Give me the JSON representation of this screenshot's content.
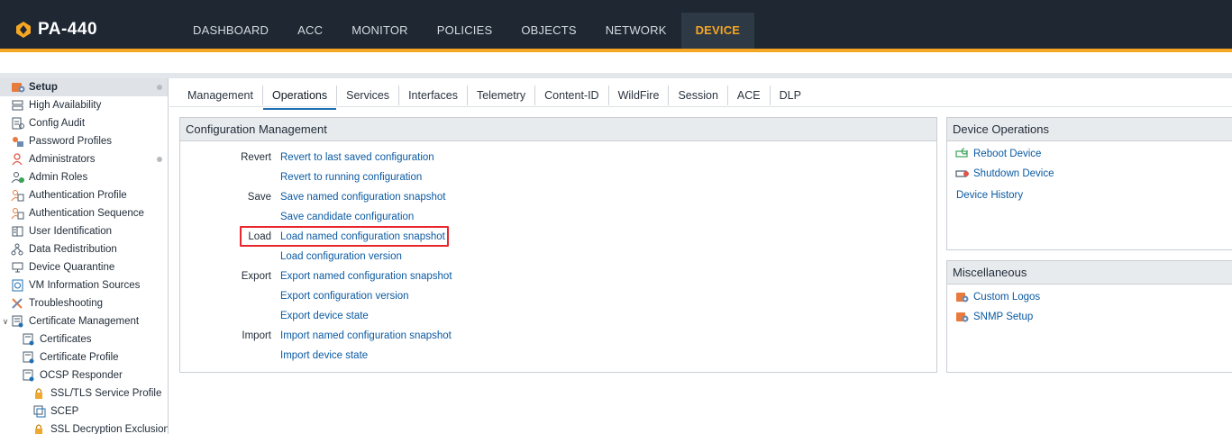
{
  "brand": {
    "name": "PA-440",
    "accent_color": "#f5a623",
    "header_bg": "#1e2732"
  },
  "nav": {
    "items": [
      {
        "label": "DASHBOARD",
        "active": false
      },
      {
        "label": "ACC",
        "active": false
      },
      {
        "label": "MONITOR",
        "active": false
      },
      {
        "label": "POLICIES",
        "active": false
      },
      {
        "label": "OBJECTS",
        "active": false
      },
      {
        "label": "NETWORK",
        "active": false
      },
      {
        "label": "DEVICE",
        "active": true
      }
    ]
  },
  "sidebar": {
    "items": [
      {
        "label": "Setup",
        "icon": "setup-icon",
        "selected": true,
        "dot": true
      },
      {
        "label": "High Availability",
        "icon": "high-availability-icon"
      },
      {
        "label": "Config Audit",
        "icon": "config-audit-icon"
      },
      {
        "label": "Password Profiles",
        "icon": "password-profiles-icon"
      },
      {
        "label": "Administrators",
        "icon": "administrators-icon",
        "dot": true
      },
      {
        "label": "Admin Roles",
        "icon": "admin-roles-icon"
      },
      {
        "label": "Authentication Profile",
        "icon": "authentication-profile-icon"
      },
      {
        "label": "Authentication Sequence",
        "icon": "authentication-sequence-icon"
      },
      {
        "label": "User Identification",
        "icon": "user-identification-icon"
      },
      {
        "label": "Data Redistribution",
        "icon": "data-redistribution-icon"
      },
      {
        "label": "Device Quarantine",
        "icon": "device-quarantine-icon"
      },
      {
        "label": "VM Information Sources",
        "icon": "vm-information-sources-icon"
      },
      {
        "label": "Troubleshooting",
        "icon": "troubleshooting-icon"
      },
      {
        "label": "Certificate Management",
        "icon": "certificate-management-icon",
        "expanded": true
      },
      {
        "label": "Certificates",
        "icon": "certificates-icon",
        "child": true
      },
      {
        "label": "Certificate Profile",
        "icon": "certificate-profile-icon",
        "child": true
      },
      {
        "label": "OCSP Responder",
        "icon": "ocsp-responder-icon",
        "child": true
      },
      {
        "label": "SSL/TLS Service Profile",
        "icon": "lock-icon",
        "child": true
      },
      {
        "label": "SCEP",
        "icon": "scep-icon",
        "child": true
      },
      {
        "label": "SSL Decryption Exclusion",
        "icon": "lock-icon",
        "child": true
      }
    ]
  },
  "tabs": [
    {
      "label": "Management",
      "active": false
    },
    {
      "label": "Operations",
      "active": true
    },
    {
      "label": "Services",
      "active": false
    },
    {
      "label": "Interfaces",
      "active": false
    },
    {
      "label": "Telemetry",
      "active": false
    },
    {
      "label": "Content-ID",
      "active": false
    },
    {
      "label": "WildFire",
      "active": false
    },
    {
      "label": "Session",
      "active": false
    },
    {
      "label": "ACE",
      "active": false
    },
    {
      "label": "DLP",
      "active": false
    }
  ],
  "config_mgmt": {
    "title": "Configuration Management",
    "rows": [
      {
        "label": "Revert",
        "link": "Revert to last saved configuration"
      },
      {
        "label": "",
        "link": "Revert to running configuration"
      },
      {
        "label": "Save",
        "link": "Save named configuration snapshot"
      },
      {
        "label": "",
        "link": "Save candidate configuration"
      },
      {
        "label": "Load",
        "link": "Load named configuration snapshot",
        "highlighted": true
      },
      {
        "label": "",
        "link": "Load configuration version"
      },
      {
        "label": "Export",
        "link": "Export named configuration snapshot"
      },
      {
        "label": "",
        "link": "Export configuration version"
      },
      {
        "label": "",
        "link": "Export device state"
      },
      {
        "label": "Import",
        "link": "Import named configuration snapshot"
      },
      {
        "label": "",
        "link": "Import device state"
      }
    ]
  },
  "device_ops": {
    "title": "Device Operations",
    "items": [
      {
        "label": "Reboot Device",
        "icon": "reboot-icon"
      },
      {
        "label": "Shutdown Device",
        "icon": "shutdown-icon"
      },
      {
        "label": "Device History",
        "icon": ""
      }
    ]
  },
  "misc": {
    "title": "Miscellaneous",
    "items": [
      {
        "label": "Custom Logos",
        "icon": "custom-logos-icon"
      },
      {
        "label": "SNMP Setup",
        "icon": "snmp-setup-icon"
      }
    ]
  },
  "highlight_color": "#e8262c",
  "link_color": "#0b5aa2"
}
